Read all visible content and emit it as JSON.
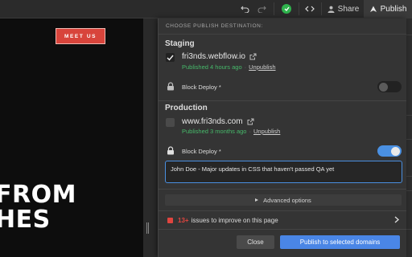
{
  "topbar": {
    "share_label": "Share",
    "publish_label": "Publish",
    "icons": [
      "undo-icon",
      "redo-icon",
      "status-check-icon",
      "code-icon",
      "user-icon",
      "publish-icon"
    ],
    "colors": {
      "status": "#2fb34d"
    }
  },
  "canvas": {
    "cta_label": "MEET US",
    "hero_lines": [
      "FROM",
      "HES"
    ]
  },
  "popup": {
    "header": "CHOOSE PUBLISH DESTINATION:",
    "staging": {
      "title": "Staging",
      "domain": "fri3nds.webflow.io",
      "checked": true,
      "published_text": "Published 4 hours ago",
      "separator": "·",
      "unpublish_label": "Unpublish",
      "block_deploy_label": "Block Deploy *",
      "block_deploy_on": false
    },
    "production": {
      "title": "Production",
      "domain": "www.fri3nds.com",
      "checked": false,
      "published_text": "Published 3 months ago",
      "separator": "·",
      "unpublish_label": "Unpublish",
      "block_deploy_label": "Block Deploy *",
      "block_deploy_on": true,
      "note_value": "John Doe - Major updates in CSS that haven't passed QA yet"
    },
    "advanced_label": "Advanced options",
    "issues": {
      "count": "13+",
      "text": "issues to improve on this page"
    },
    "close_label": "Close",
    "publish_selected_label": "Publish to selected domains",
    "colors": {
      "accent": "#4a86e6",
      "published": "#46b96a",
      "issue": "#e0453f"
    }
  }
}
